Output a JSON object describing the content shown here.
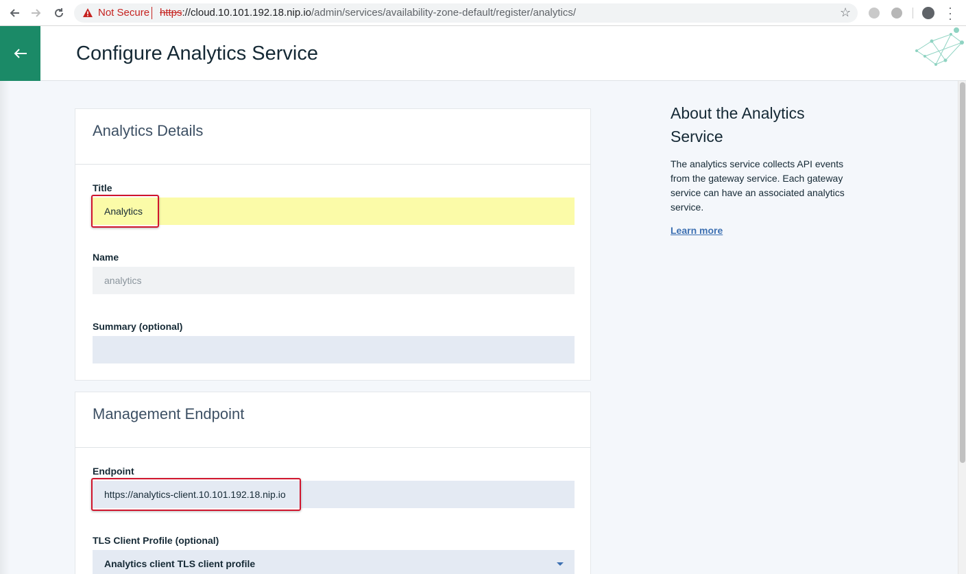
{
  "browser": {
    "security_label": "Not Secure",
    "url_scheme": "https",
    "url_host": "://cloud.10.101.192.18.nip.io",
    "url_path": "/admin/services/availability-zone-default/register/analytics/"
  },
  "header": {
    "title": "Configure Analytics Service"
  },
  "details_card": {
    "title": "Analytics Details",
    "title_label": "Title",
    "title_value": "Analytics",
    "name_label": "Name",
    "name_value": "analytics",
    "summary_label": "Summary (optional)",
    "summary_value": ""
  },
  "endpoint_card": {
    "title": "Management Endpoint",
    "endpoint_label": "Endpoint",
    "endpoint_value": "https://analytics-client.10.101.192.18.nip.io",
    "tls_label": "TLS Client Profile (optional)",
    "tls_value": "Analytics client TLS client profile"
  },
  "about": {
    "title": "About the Analytics Service",
    "text": "The analytics service collects API events from the gateway service. Each gateway service can have an associated analytics service.",
    "link": "Learn more"
  },
  "colors": {
    "brand_green": "#1b8a67",
    "highlight": "#fbfba8",
    "callout_red": "#d0142c",
    "link_blue": "#3d70b2"
  }
}
